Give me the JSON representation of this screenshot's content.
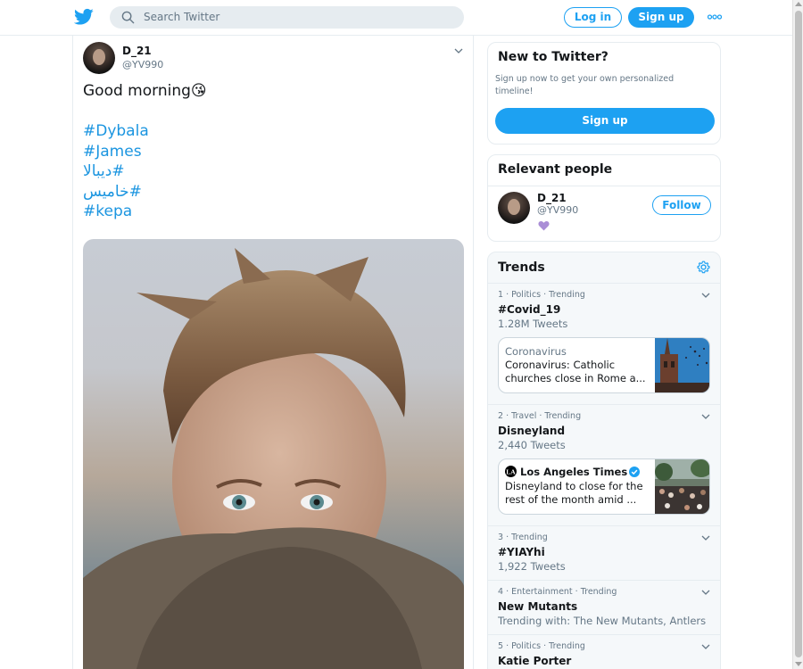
{
  "header": {
    "search_placeholder": "Search Twitter",
    "login_label": "Log in",
    "signup_label": "Sign up",
    "brand_color": "#1da1f2"
  },
  "tweet": {
    "author_name": "D_21",
    "author_handle": "@YV990",
    "text": "Good morning😘",
    "hashtags": [
      "#Dybala",
      "#James",
      "#ديبالا",
      "#خاميس",
      "#kepa"
    ],
    "link_color": "#1b95e0"
  },
  "new_to_twitter": {
    "title": "New to Twitter?",
    "description": "Sign up now to get your own personalized timeline!",
    "button_label": "Sign up"
  },
  "relevant_people": {
    "title": "Relevant people",
    "person": {
      "name": "D_21",
      "handle": "@YV990",
      "bio_emoji": "purple-heart",
      "follow_label": "Follow"
    }
  },
  "trends": {
    "title": "Trends",
    "items": [
      {
        "meta": "1 · Politics · Trending",
        "name": "#Covid_19",
        "count": "1.28M Tweets",
        "news": {
          "topic": "Coronavirus",
          "headline": "Coronavirus: Catholic churches close in Rome a..."
        }
      },
      {
        "meta": "2 · Travel · Trending",
        "name": "Disneyland",
        "count": "2,440 Tweets",
        "news": {
          "source": "Los Angeles Times",
          "headline": "Disneyland to close for the rest of the month amid ..."
        }
      },
      {
        "meta": "3 · Trending",
        "name": "#YIAYhi",
        "count": "1,922 Tweets"
      },
      {
        "meta": "4 · Entertainment · Trending",
        "name": "New Mutants",
        "count": "Trending with: The New Mutants, Antlers"
      },
      {
        "meta": "5 · Politics · Trending",
        "name": "Katie Porter",
        "count": ""
      }
    ]
  }
}
